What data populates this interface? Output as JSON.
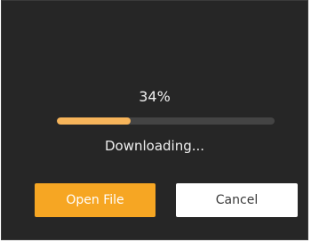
{
  "dialog": {
    "progress": {
      "percent_label": "34%",
      "value": 0.34,
      "fill_color": "#f6b45a",
      "track_color": "#444444"
    },
    "status_text": "Downloading...",
    "buttons": {
      "open_file_label": "Open File",
      "cancel_label": "Cancel"
    },
    "colors": {
      "background": "#262626",
      "primary": "#f6a623",
      "secondary": "#ffffff"
    }
  }
}
